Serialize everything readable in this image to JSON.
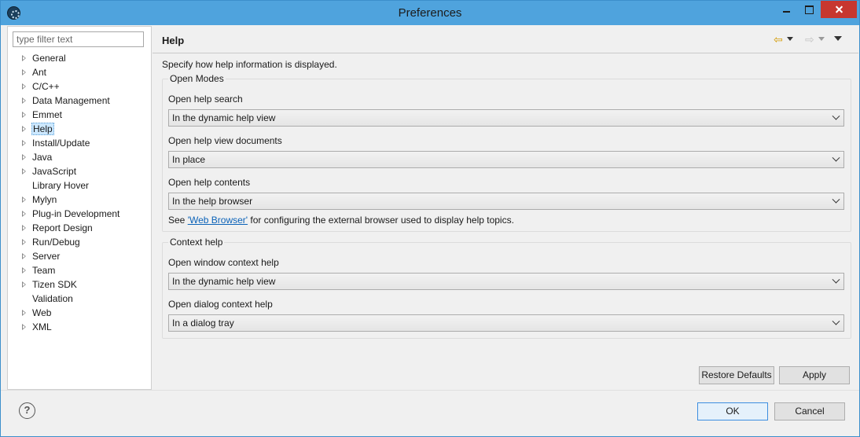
{
  "window": {
    "title": "Preferences"
  },
  "sidebar": {
    "filter_placeholder": "type filter text",
    "items": [
      {
        "label": "General",
        "expandable": true
      },
      {
        "label": "Ant",
        "expandable": true
      },
      {
        "label": "C/C++",
        "expandable": true
      },
      {
        "label": "Data Management",
        "expandable": true
      },
      {
        "label": "Emmet",
        "expandable": true
      },
      {
        "label": "Help",
        "expandable": true,
        "selected": true
      },
      {
        "label": "Install/Update",
        "expandable": true
      },
      {
        "label": "Java",
        "expandable": true
      },
      {
        "label": "JavaScript",
        "expandable": true
      },
      {
        "label": "Library Hover",
        "expandable": false
      },
      {
        "label": "Mylyn",
        "expandable": true
      },
      {
        "label": "Plug-in Development",
        "expandable": true
      },
      {
        "label": "Report Design",
        "expandable": true
      },
      {
        "label": "Run/Debug",
        "expandable": true
      },
      {
        "label": "Server",
        "expandable": true
      },
      {
        "label": "Team",
        "expandable": true
      },
      {
        "label": "Tizen SDK",
        "expandable": true
      },
      {
        "label": "Validation",
        "expandable": false
      },
      {
        "label": "Web",
        "expandable": true
      },
      {
        "label": "XML",
        "expandable": true
      }
    ]
  },
  "page": {
    "title": "Help",
    "description": "Specify how help information is displayed.",
    "open_modes": {
      "title": "Open Modes",
      "search_label": "Open help search",
      "search_value": "In the dynamic help view",
      "documents_label": "Open help view documents",
      "documents_value": "In place",
      "contents_label": "Open help contents",
      "contents_value": "In the help browser",
      "note_prefix": "See ",
      "note_link": "'Web Browser'",
      "note_suffix": " for configuring the external browser used to display help topics."
    },
    "context_help": {
      "title": "Context help",
      "window_label": "Open window context help",
      "window_value": "In the dynamic help view",
      "dialog_label": "Open dialog context help",
      "dialog_value": "In a dialog tray"
    },
    "buttons": {
      "restore": "Restore Defaults",
      "apply": "Apply"
    }
  },
  "footer": {
    "help_glyph": "?",
    "ok": "OK",
    "cancel": "Cancel"
  },
  "icons": {
    "back": "back-arrow-icon",
    "forward": "forward-arrow-icon",
    "view_menu": "view-menu-icon"
  }
}
